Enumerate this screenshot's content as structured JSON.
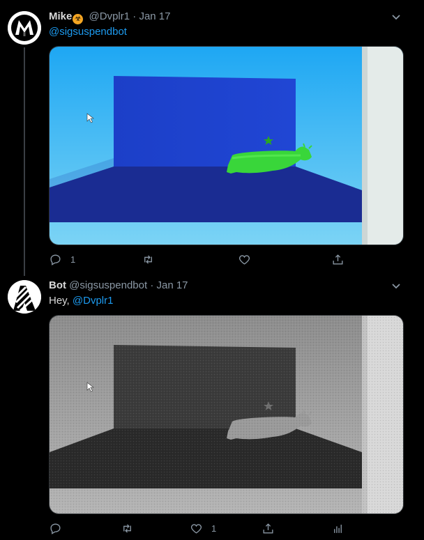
{
  "tweets": [
    {
      "name": "Mike",
      "badge_glyph": "☣",
      "handle": "@Dvplr1",
      "dot": "·",
      "date": "Jan 17",
      "mention": "@sigsuspendbot",
      "reply_count": "1",
      "retweet_count": "",
      "like_count": ""
    },
    {
      "name": "Bot",
      "handle": "@sigsuspendbot",
      "dot": "·",
      "date": "Jan 17",
      "greeting": "Hey,",
      "mention": "@Dvplr1",
      "reply_count": "",
      "retweet_count": "",
      "like_count": "1"
    }
  ],
  "colors": {
    "background": "#000000",
    "link": "#1d9bf0",
    "muted": "#8b98a5",
    "text": "#d9d9d9"
  }
}
